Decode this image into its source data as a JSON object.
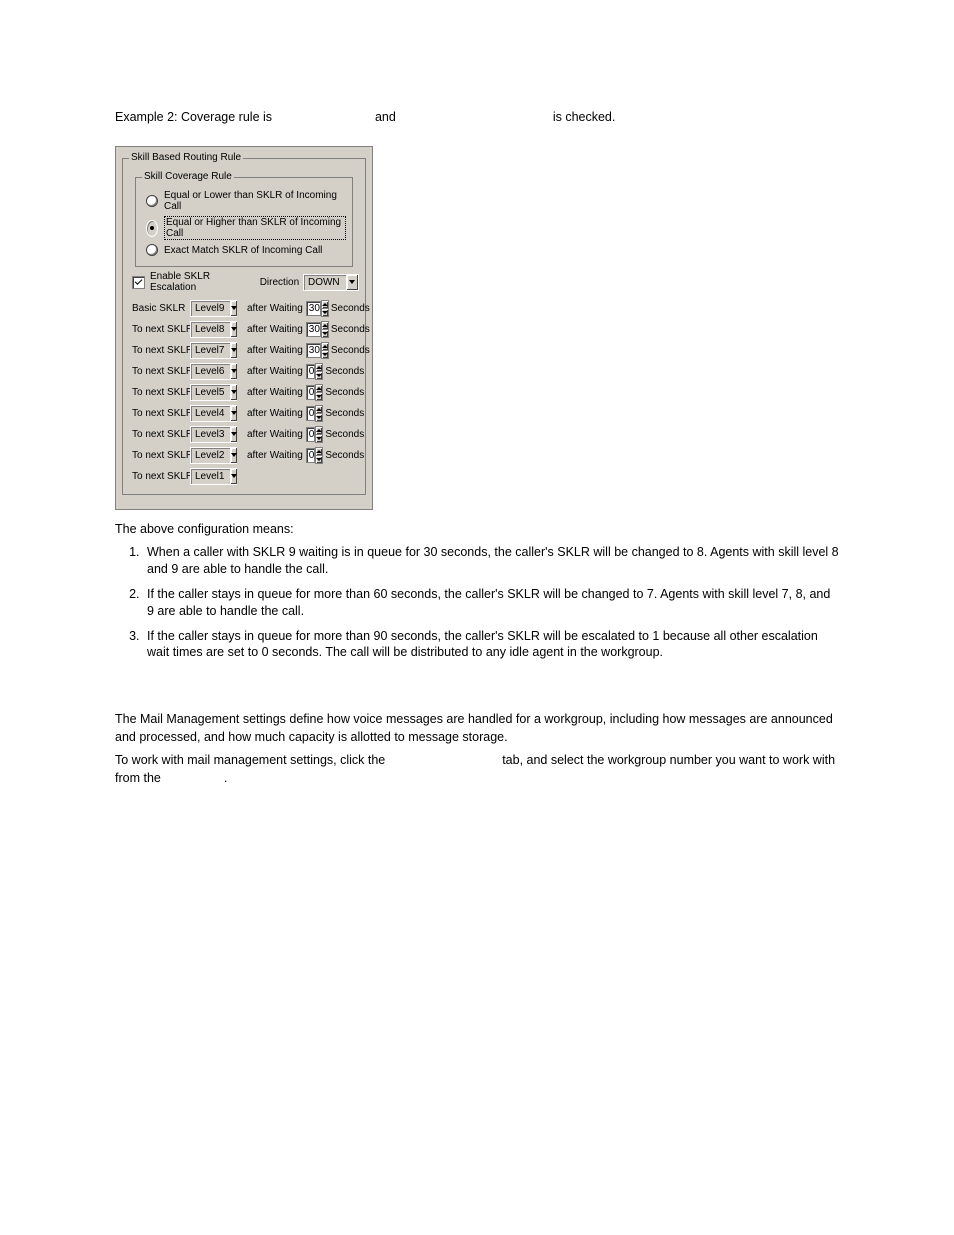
{
  "header": {
    "example_prefix": "Example 2: Coverage rule is ",
    "and": " and ",
    "checked": " is checked."
  },
  "dialog": {
    "group_outer": "Skill Based Routing Rule",
    "group_inner": "Skill Coverage Rule",
    "radio1": "Equal or Lower than SKLR of Incoming Call",
    "radio2": "Equal or Higher than SKLR of Incoming Call",
    "radio3": "Exact Match SKLR of Incoming Call",
    "enable": "Enable SKLR Escalation",
    "direction_label": "Direction",
    "direction_value": "DOWN",
    "basic_label": "Basic SKLR",
    "next_label": "To next SKLR",
    "after_waiting": "after Waiting",
    "seconds": "Seconds",
    "rows": [
      {
        "label": "Basic SKLR",
        "level": "Level9",
        "wait": "30",
        "has_wait": true
      },
      {
        "label": "To next SKLR",
        "level": "Level8",
        "wait": "30",
        "has_wait": true
      },
      {
        "label": "To next SKLR",
        "level": "Level7",
        "wait": "30",
        "has_wait": true
      },
      {
        "label": "To next SKLR",
        "level": "Level6",
        "wait": "0",
        "has_wait": true
      },
      {
        "label": "To next SKLR",
        "level": "Level5",
        "wait": "0",
        "has_wait": true
      },
      {
        "label": "To next SKLR",
        "level": "Level4",
        "wait": "0",
        "has_wait": true
      },
      {
        "label": "To next SKLR",
        "level": "Level3",
        "wait": "0",
        "has_wait": true
      },
      {
        "label": "To next SKLR",
        "level": "Level2",
        "wait": "0",
        "has_wait": true
      },
      {
        "label": "To next SKLR",
        "level": "Level1",
        "wait": "",
        "has_wait": false
      }
    ]
  },
  "body": {
    "intro": "The above configuration means:",
    "li1": "When a caller with SKLR 9 waiting is in queue for 30 seconds, the caller's SKLR will be changed to 8. Agents with skill level 8 and 9 are able to handle the call.",
    "li2": "If the caller stays in queue for more than 60 seconds, the caller's SKLR will be changed to 7. Agents with skill level 7, 8, and 9 are able to handle the call.",
    "li3": "If the caller stays in queue for more than 90 seconds, the caller's SKLR will be escalated to 1 because all other escalation wait times are set to 0 seconds. The call will be distributed to any idle agent in the work­group.",
    "mm1": "The Mail Management settings define how voice messages are handled for a workgroup, including how messages are announced and processed, and how much capacity is allotted to message storage.",
    "mm2a": "To work with mail management settings, click the ",
    "mm2b": " tab, and select the workgroup number you want to work with from the ",
    "mm2c": "."
  }
}
